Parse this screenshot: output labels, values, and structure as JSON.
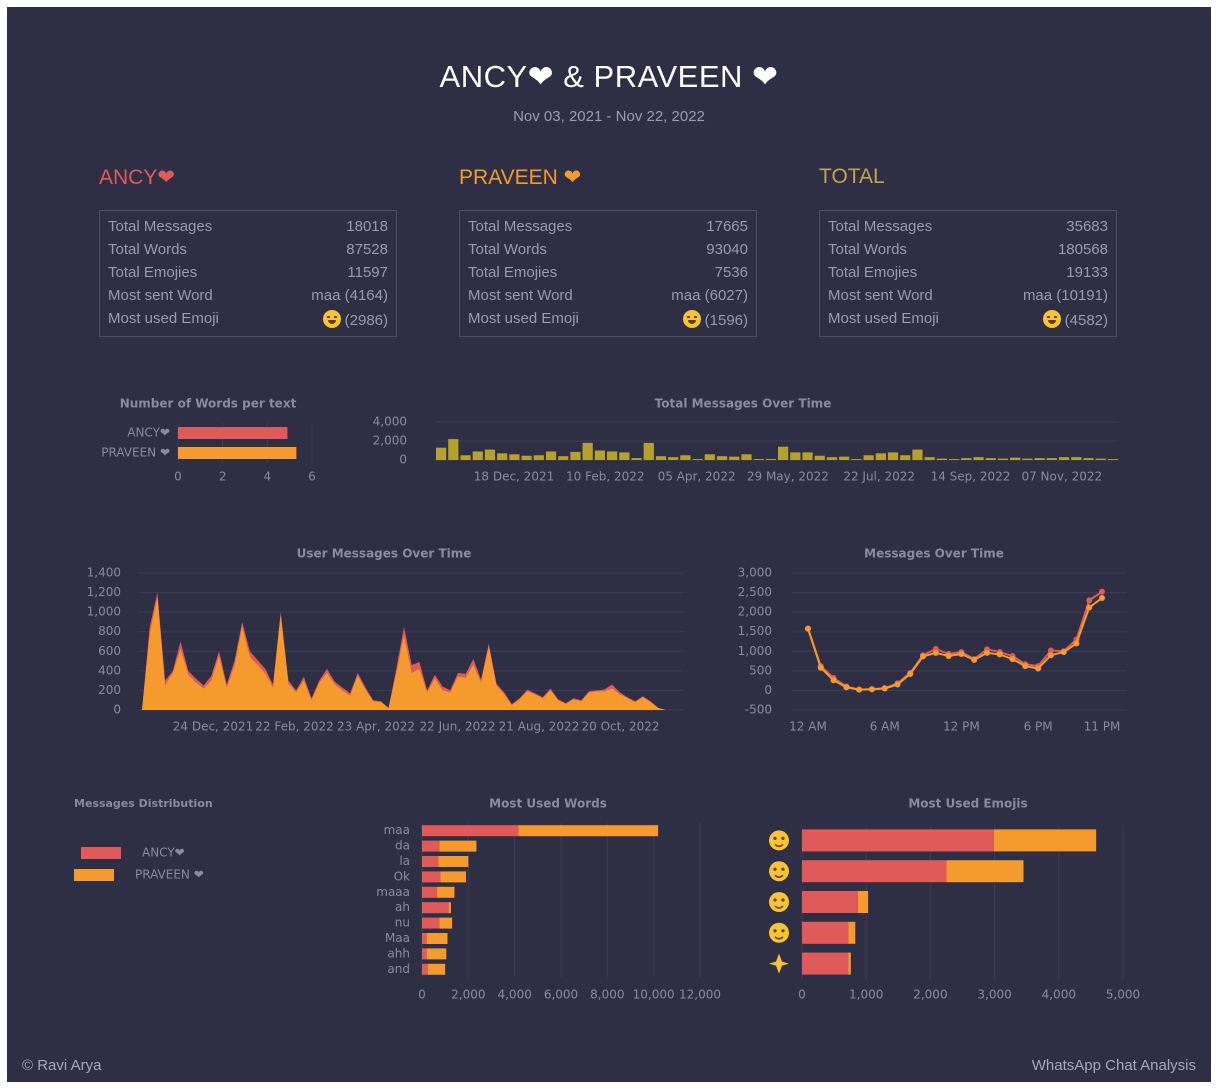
{
  "header": {
    "title": "ANCY❤ & PRAVEEN ❤",
    "date_range": "Nov 03, 2021 - Nov 22, 2022"
  },
  "colors": {
    "background": "#2e2e44",
    "ancy": "#e05a5a",
    "praveen": "#f59b2d",
    "total": "#c7a24a",
    "bars_time": "#b4a22c",
    "text_muted": "#9a9ab0"
  },
  "stats": {
    "labels": {
      "messages": "Total Messages",
      "words": "Total Words",
      "emojis": "Total Emojies",
      "word": "Most sent Word",
      "emoji": "Most used Emoji"
    },
    "ancy": {
      "name": "ANCY❤",
      "messages": "18018",
      "words": "87528",
      "emojis": "11597",
      "top_word": "maa (4164)",
      "top_emoji_icon": "hugging-face-icon",
      "top_emoji_count": "(2986)"
    },
    "praveen": {
      "name": "PRAVEEN ❤",
      "messages": "17665",
      "words": "93040",
      "emojis": "7536",
      "top_word": "maa (6027)",
      "top_emoji_icon": "hugging-face-icon",
      "top_emoji_count": "(1596)"
    },
    "total": {
      "name": "TOTAL",
      "messages": "35683",
      "words": "180568",
      "emojis": "19133",
      "top_word": "maa (10191)",
      "top_emoji_icon": "hugging-face-icon",
      "top_emoji_count": "(4582)"
    }
  },
  "footer": {
    "left": "© Ravi Arya",
    "right": "WhatsApp Chat Analysis"
  },
  "chart_data": [
    {
      "id": "words_per_text",
      "type": "bar",
      "orientation": "horizontal",
      "title": "Number of Words per text",
      "categories": [
        "ANCY❤",
        "PRAVEEN ❤"
      ],
      "values": [
        4.9,
        5.3
      ],
      "xlim": [
        0,
        6
      ],
      "xticks": [
        "0",
        "2",
        "4",
        "6"
      ]
    },
    {
      "id": "total_messages_over_time",
      "type": "bar",
      "title": "Total Messages Over Time",
      "x": [
        "2021-11-03",
        "2021-11-10",
        "2021-11-17",
        "2021-11-24",
        "2021-12-01",
        "2021-12-08",
        "2021-12-15",
        "2021-12-22",
        "2021-12-29",
        "2022-01-05",
        "2022-01-12",
        "2022-01-19",
        "2022-01-26",
        "2022-02-02",
        "2022-02-09",
        "2022-02-16",
        "2022-02-23",
        "2022-03-02",
        "2022-03-09",
        "2022-03-16",
        "2022-03-23",
        "2022-03-30",
        "2022-04-06",
        "2022-04-13",
        "2022-04-20",
        "2022-04-27",
        "2022-05-04",
        "2022-05-11",
        "2022-05-18",
        "2022-05-25",
        "2022-06-01",
        "2022-06-08",
        "2022-06-15",
        "2022-06-22",
        "2022-06-29",
        "2022-07-06",
        "2022-07-13",
        "2022-07-20",
        "2022-07-27",
        "2022-08-03",
        "2022-08-10",
        "2022-08-17",
        "2022-08-24",
        "2022-08-31",
        "2022-09-07",
        "2022-09-14",
        "2022-09-21",
        "2022-09-28",
        "2022-10-05",
        "2022-10-12",
        "2022-10-19",
        "2022-10-26",
        "2022-11-02",
        "2022-11-09",
        "2022-11-16",
        "2022-11-23"
      ],
      "values": [
        1300,
        2200,
        500,
        900,
        1100,
        700,
        600,
        450,
        500,
        900,
        400,
        850,
        1800,
        1000,
        900,
        800,
        200,
        1800,
        400,
        300,
        500,
        100,
        600,
        400,
        350,
        600,
        100,
        100,
        1400,
        800,
        800,
        450,
        300,
        350,
        100,
        500,
        700,
        800,
        500,
        1100,
        300,
        150,
        100,
        200,
        300,
        200,
        150,
        250,
        150,
        200,
        200,
        300,
        300,
        200,
        150,
        100
      ],
      "ylim": [
        0,
        4000
      ],
      "yticks": [
        "4,000",
        "2,000",
        "0"
      ],
      "xticks": [
        "18 Dec, 2021",
        "10 Feb, 2022",
        "05 Apr, 2022",
        "29 May, 2022",
        "22 Jul, 2022",
        "14 Sep, 2022",
        "07 Nov, 2022"
      ]
    },
    {
      "id": "user_messages_over_time",
      "type": "area",
      "stacked": true,
      "title": "User Messages Over Time",
      "x_start": "2021-11-03",
      "x_end": "2022-11-22",
      "series": [
        {
          "name": "ANCY❤",
          "values": [
            0,
            850,
            1200,
            300,
            400,
            700,
            400,
            320,
            250,
            350,
            600,
            260,
            500,
            900,
            600,
            510,
            420,
            260,
            1000,
            300,
            200,
            340,
            120,
            300,
            420,
            290,
            230,
            170,
            380,
            230,
            100,
            90,
            20,
            420,
            850,
            460,
            490,
            200,
            360,
            240,
            200,
            380,
            370,
            520,
            310,
            680,
            270,
            180,
            60,
            120,
            210,
            170,
            130,
            220,
            110,
            70,
            120,
            100,
            190,
            200,
            210,
            260,
            180,
            130,
            90,
            140,
            90,
            20,
            0
          ]
        },
        {
          "name": "PRAVEEN ❤",
          "values": [
            0,
            780,
            1150,
            250,
            380,
            620,
            360,
            280,
            220,
            300,
            550,
            230,
            450,
            850,
            540,
            460,
            370,
            230,
            980,
            270,
            180,
            300,
            100,
            280,
            380,
            260,
            200,
            150,
            350,
            210,
            90,
            80,
            20,
            380,
            760,
            380,
            420,
            180,
            320,
            200,
            180,
            340,
            330,
            460,
            280,
            650,
            250,
            160,
            50,
            110,
            190,
            160,
            120,
            200,
            100,
            60,
            110,
            90,
            180,
            190,
            190,
            220,
            160,
            120,
            80,
            130,
            80,
            20,
            0
          ]
        }
      ],
      "ylim": [
        0,
        1400
      ],
      "yticks": [
        "1,400",
        "1,200",
        "1,000",
        "800",
        "600",
        "400",
        "200",
        "0"
      ],
      "xticks": [
        "24 Dec, 2021",
        "22 Feb, 2022",
        "23 Apr, 2022",
        "22 Jun, 2022",
        "21 Aug, 2022",
        "20 Oct, 2022"
      ]
    },
    {
      "id": "messages_over_time_hourly",
      "type": "line",
      "title": "Messages Over Time",
      "x": [
        "12 AM",
        "1 AM",
        "2 AM",
        "3 AM",
        "4 AM",
        "5 AM",
        "6 AM",
        "7 AM",
        "8 AM",
        "9 AM",
        "10 AM",
        "11 AM",
        "12 PM",
        "1 PM",
        "2 PM",
        "3 PM",
        "4 PM",
        "5 PM",
        "6 PM",
        "7 PM",
        "8 PM",
        "9 PM",
        "10 PM",
        "11 PM"
      ],
      "series": [
        {
          "name": "ANCY❤",
          "values": [
            1580,
            620,
            320,
            100,
            20,
            30,
            60,
            180,
            450,
            900,
            1060,
            930,
            980,
            800,
            1050,
            980,
            880,
            670,
            620,
            1020,
            1000,
            1300,
            2300,
            2520
          ]
        },
        {
          "name": "PRAVEEN ❤",
          "values": [
            1580,
            580,
            260,
            80,
            20,
            30,
            50,
            150,
            420,
            870,
            960,
            880,
            930,
            780,
            960,
            920,
            800,
            620,
            560,
            900,
            980,
            1200,
            2120,
            2360
          ]
        }
      ],
      "ylim": [
        -500,
        3000
      ],
      "yticks": [
        "3,000",
        "2,500",
        "2,000",
        "1,500",
        "1,000",
        "500",
        "0",
        "-500"
      ],
      "xticks": [
        "12 AM",
        "6 AM",
        "12 PM",
        "6 PM",
        "11 PM"
      ]
    },
    {
      "id": "messages_distribution",
      "type": "pie",
      "title": "Messages Distribution",
      "legend": [
        "ANCY❤",
        "PRAVEEN ❤"
      ]
    },
    {
      "id": "most_used_words",
      "type": "bar",
      "orientation": "horizontal",
      "stacked": true,
      "title": "Most Used Words",
      "categories": [
        "maa",
        "da",
        "la",
        "Ok",
        "maaa",
        "ah",
        "nu",
        "Maa",
        "ahh",
        "and"
      ],
      "series": [
        {
          "name": "ANCY❤",
          "values": [
            4164,
            750,
            700,
            800,
            650,
            1150,
            750,
            200,
            200,
            250
          ]
        },
        {
          "name": "PRAVEEN ❤",
          "values": [
            6027,
            1600,
            1300,
            1100,
            750,
            100,
            550,
            900,
            850,
            750
          ]
        }
      ],
      "xlim": [
        0,
        12000
      ],
      "xticks": [
        "0",
        "2,000",
        "4,000",
        "6,000",
        "8,000",
        "10,000",
        "12,000"
      ]
    },
    {
      "id": "most_used_emojis",
      "type": "bar",
      "orientation": "horizontal",
      "stacked": true,
      "title": "Most Used Emojis",
      "categories": [
        "hugging-face",
        "pleading-face",
        "grinning-sweat",
        "tears-of-joy",
        "sparkles"
      ],
      "series": [
        {
          "name": "ANCY❤",
          "values": [
            2986,
            2250,
            870,
            720,
            720
          ]
        },
        {
          "name": "PRAVEEN ❤",
          "values": [
            1596,
            1200,
            160,
            110,
            40
          ]
        }
      ],
      "xlim": [
        0,
        5000
      ],
      "xticks": [
        "0",
        "1,000",
        "2,000",
        "3,000",
        "4,000",
        "5,000"
      ]
    }
  ]
}
